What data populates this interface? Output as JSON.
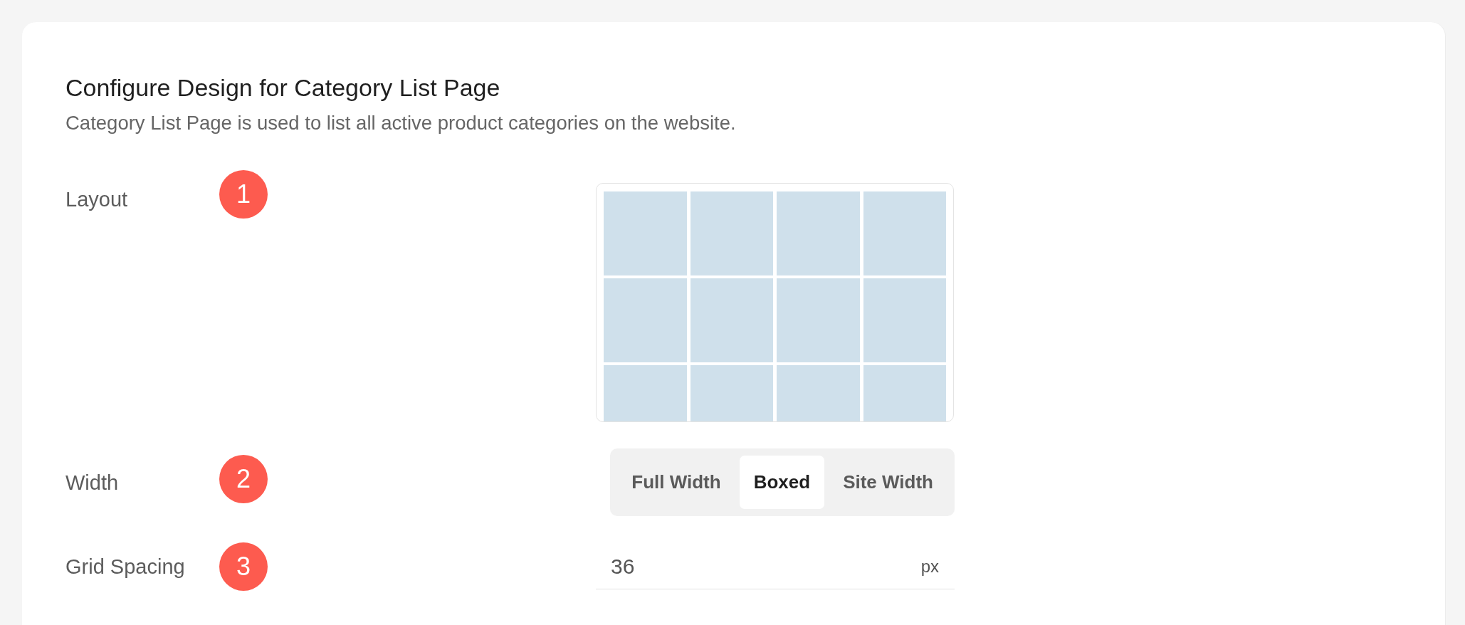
{
  "page": {
    "title": "Configure Design for Category List Page",
    "description": "Category List Page is used to list all active product categories on the website."
  },
  "settings": [
    {
      "kind": "layout",
      "label": "Layout",
      "marker": "1"
    },
    {
      "kind": "segmented",
      "label": "Width",
      "marker": "2",
      "options": [
        {
          "label": "Full Width",
          "selected": false
        },
        {
          "label": "Boxed",
          "selected": true
        },
        {
          "label": "Site Width",
          "selected": false
        }
      ]
    },
    {
      "kind": "number",
      "label": "Grid Spacing",
      "marker": "3",
      "value": "36",
      "unit": "px"
    }
  ]
}
